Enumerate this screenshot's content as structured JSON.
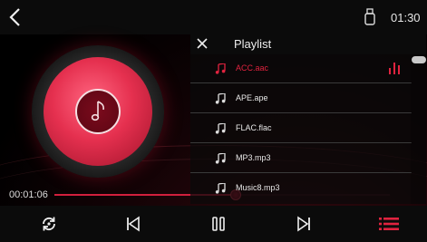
{
  "status_bar": {
    "time": "01:30",
    "usb_icon": "usb-icon",
    "back_icon": "back-chevron-icon"
  },
  "player": {
    "elapsed": "00:01:06",
    "progress_fraction": 0.54,
    "disc_icon": "music-note-icon",
    "accent_color": "#e0233f"
  },
  "playlist": {
    "title": "Playlist",
    "close_icon": "close-icon",
    "items": [
      {
        "name": "ACC.aac",
        "active": true
      },
      {
        "name": "APE.ape",
        "active": false
      },
      {
        "name": "FLAC.flac",
        "active": false
      },
      {
        "name": "MP3.mp3",
        "active": false
      },
      {
        "name": "Music8.mp3",
        "active": false
      }
    ]
  },
  "controls": [
    "repeat-icon",
    "previous-icon",
    "pause-icon",
    "next-icon",
    "playlist-icon"
  ]
}
